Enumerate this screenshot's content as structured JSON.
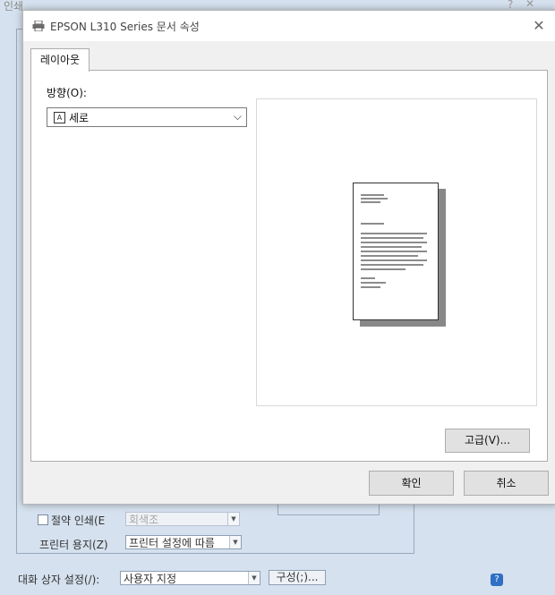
{
  "background": {
    "title": "인쇄",
    "help_icon": "?",
    "close_icon": "✕",
    "toner_save_label": "절약 인쇄(E",
    "toner_mode_value": "회색조",
    "paper_label": "프린터 용지(Z)",
    "paper_value": "프린터 설정에 따름",
    "dialog_setting_label": "대화 상자 설정(/):",
    "dialog_setting_value": "사용자 지정",
    "config_button": "구성(;)...",
    "help_button": "?"
  },
  "dialog": {
    "title": "EPSON L310 Series 문서 속성",
    "close": "✕",
    "tabs": [
      {
        "label": "레이아웃"
      }
    ],
    "orientation": {
      "label": "방향(O):",
      "icon_glyph": "A",
      "value": "세로",
      "chevron": "⌵"
    },
    "advanced_button": "고급(V)...",
    "ok_button": "확인",
    "cancel_button": "취소"
  },
  "colors": {
    "dialog_bg": "#f0f0f0",
    "panel_bg": "#ffffff",
    "button_bg": "#e1e1e1",
    "background_window": "#d5e1ee"
  }
}
